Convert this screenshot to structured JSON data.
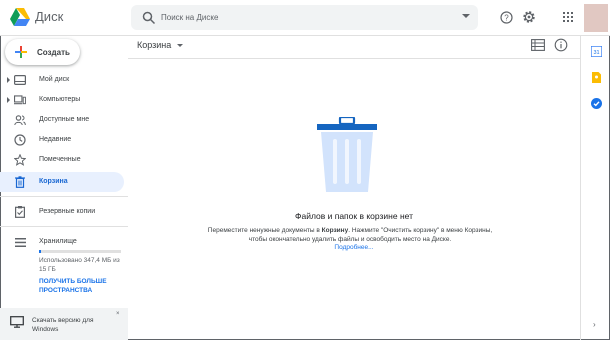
{
  "app": {
    "title": "Диск"
  },
  "search": {
    "placeholder": "Поиск на Диске"
  },
  "new_button": {
    "label": "Создать"
  },
  "sidebar": {
    "items": [
      {
        "label": "Мой диск",
        "icon": "my-drive-icon"
      },
      {
        "label": "Компьютеры",
        "icon": "computers-icon"
      },
      {
        "label": "Доступные мне",
        "icon": "shared-with-me-icon"
      },
      {
        "label": "Недавние",
        "icon": "clock-icon"
      },
      {
        "label": "Помеченные",
        "icon": "star-icon"
      },
      {
        "label": "Корзина",
        "icon": "trash-icon",
        "active": true
      },
      {
        "label": "Резервные копии",
        "icon": "backup-icon"
      }
    ]
  },
  "storage": {
    "label": "Хранилище",
    "used_text": "Использовано 347,4 МБ из 15 ГБ",
    "used_fraction": 0.023,
    "buy_label": "ПОЛУЧИТЬ БОЛЬШЕ ПРОСТРАНСТВА"
  },
  "download": {
    "text": "Скачать версию для Windows",
    "close": "×"
  },
  "main": {
    "title": "Корзина",
    "empty_title": "Файлов и папок в корзине нет",
    "empty_desc_1": "Переместите ненужные документы в ",
    "empty_desc_bold": "Корзину",
    "empty_desc_2": ". Нажмите \"Очистить корзину\" в меню Корзины, чтобы окончательно удалить файлы и освободить место на Диске.",
    "learn_more": "Подробнее..."
  },
  "right_panel": {
    "calendar_day": "31",
    "expand": "›"
  },
  "colors": {
    "accent": "#1a73e8",
    "active_bg": "#e8f0fe",
    "trash_blue": "#1565c0",
    "trash_light": "#d2e3fc"
  }
}
